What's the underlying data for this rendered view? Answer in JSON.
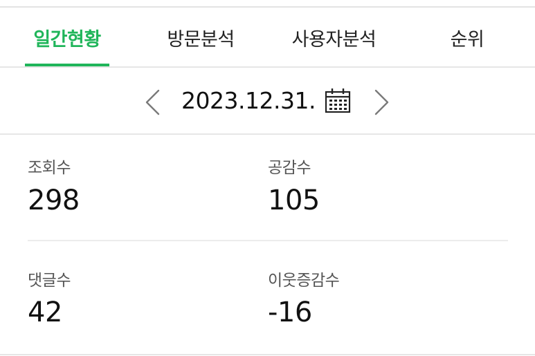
{
  "tabs": [
    {
      "label": "일간현황",
      "active": true
    },
    {
      "label": "방문분석",
      "active": false
    },
    {
      "label": "사용자분석",
      "active": false
    },
    {
      "label": "순위",
      "active": false
    }
  ],
  "date_nav": {
    "date": "2023.12.31.",
    "prev_icon": "chevron-left-icon",
    "next_icon": "chevron-right-icon",
    "calendar_icon": "calendar-icon"
  },
  "stats": [
    {
      "label": "조회수",
      "value": "298"
    },
    {
      "label": "공감수",
      "value": "105"
    },
    {
      "label": "댓글수",
      "value": "42"
    },
    {
      "label": "이웃증감수",
      "value": "-16"
    }
  ],
  "colors": {
    "accent": "#20b55a",
    "divider": "#e6e6e6",
    "text": "#111111"
  }
}
